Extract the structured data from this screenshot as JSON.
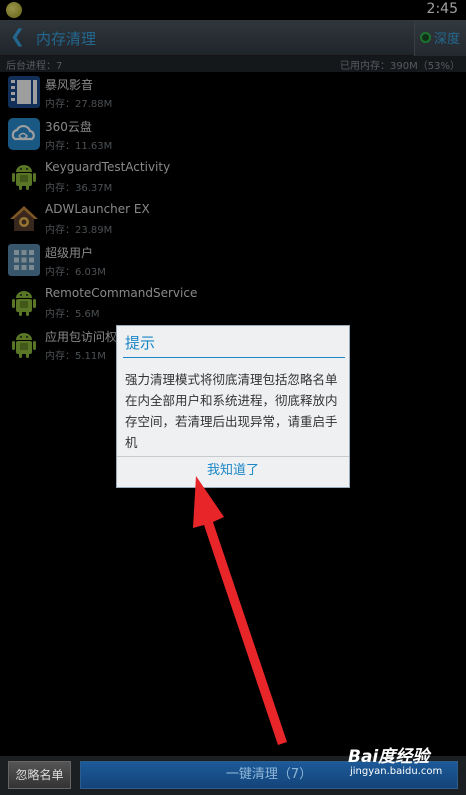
{
  "status_bar": {
    "time": "2:45"
  },
  "title_bar": {
    "title": "内存清理",
    "mode_label": "深度"
  },
  "info_bar": {
    "background_processes": "后台进程：7",
    "used_memory": "已用内存：390M（53%）"
  },
  "processes": [
    {
      "name": "暴风影音",
      "memory": "内存：27.88M",
      "icon": "film-icon"
    },
    {
      "name": "360云盘",
      "memory": "内存：11.63M",
      "icon": "cloud-icon"
    },
    {
      "name": "KeyguardTestActivity",
      "memory": "内存：36.37M",
      "icon": "android-icon"
    },
    {
      "name": "ADWLauncher EX",
      "memory": "内存：23.89M",
      "icon": "house-icon"
    },
    {
      "name": "超级用户",
      "memory": "内存：6.03M",
      "icon": "grid-icon"
    },
    {
      "name": "RemoteCommandService",
      "memory": "内存：5.6M",
      "icon": "android-icon"
    },
    {
      "name": "应用包访问权",
      "memory": "内存：5.11M",
      "icon": "android-icon"
    }
  ],
  "dialog": {
    "title": "提示",
    "message": "强力清理模式将彻底清理包括忽略名单在内全部用户和系统进程，彻底释放内存空间，若清理后出现异常，请重启手机",
    "button": "我知道了"
  },
  "bottom_bar": {
    "ignore_label": "忽略名单",
    "clean_label": "一键清理（7）"
  },
  "watermark": {
    "logo": "Bai度经验",
    "url": "jingyan.baidu.com"
  },
  "colors": {
    "accent": "#1c86c7",
    "arrow": "#e8262a"
  }
}
